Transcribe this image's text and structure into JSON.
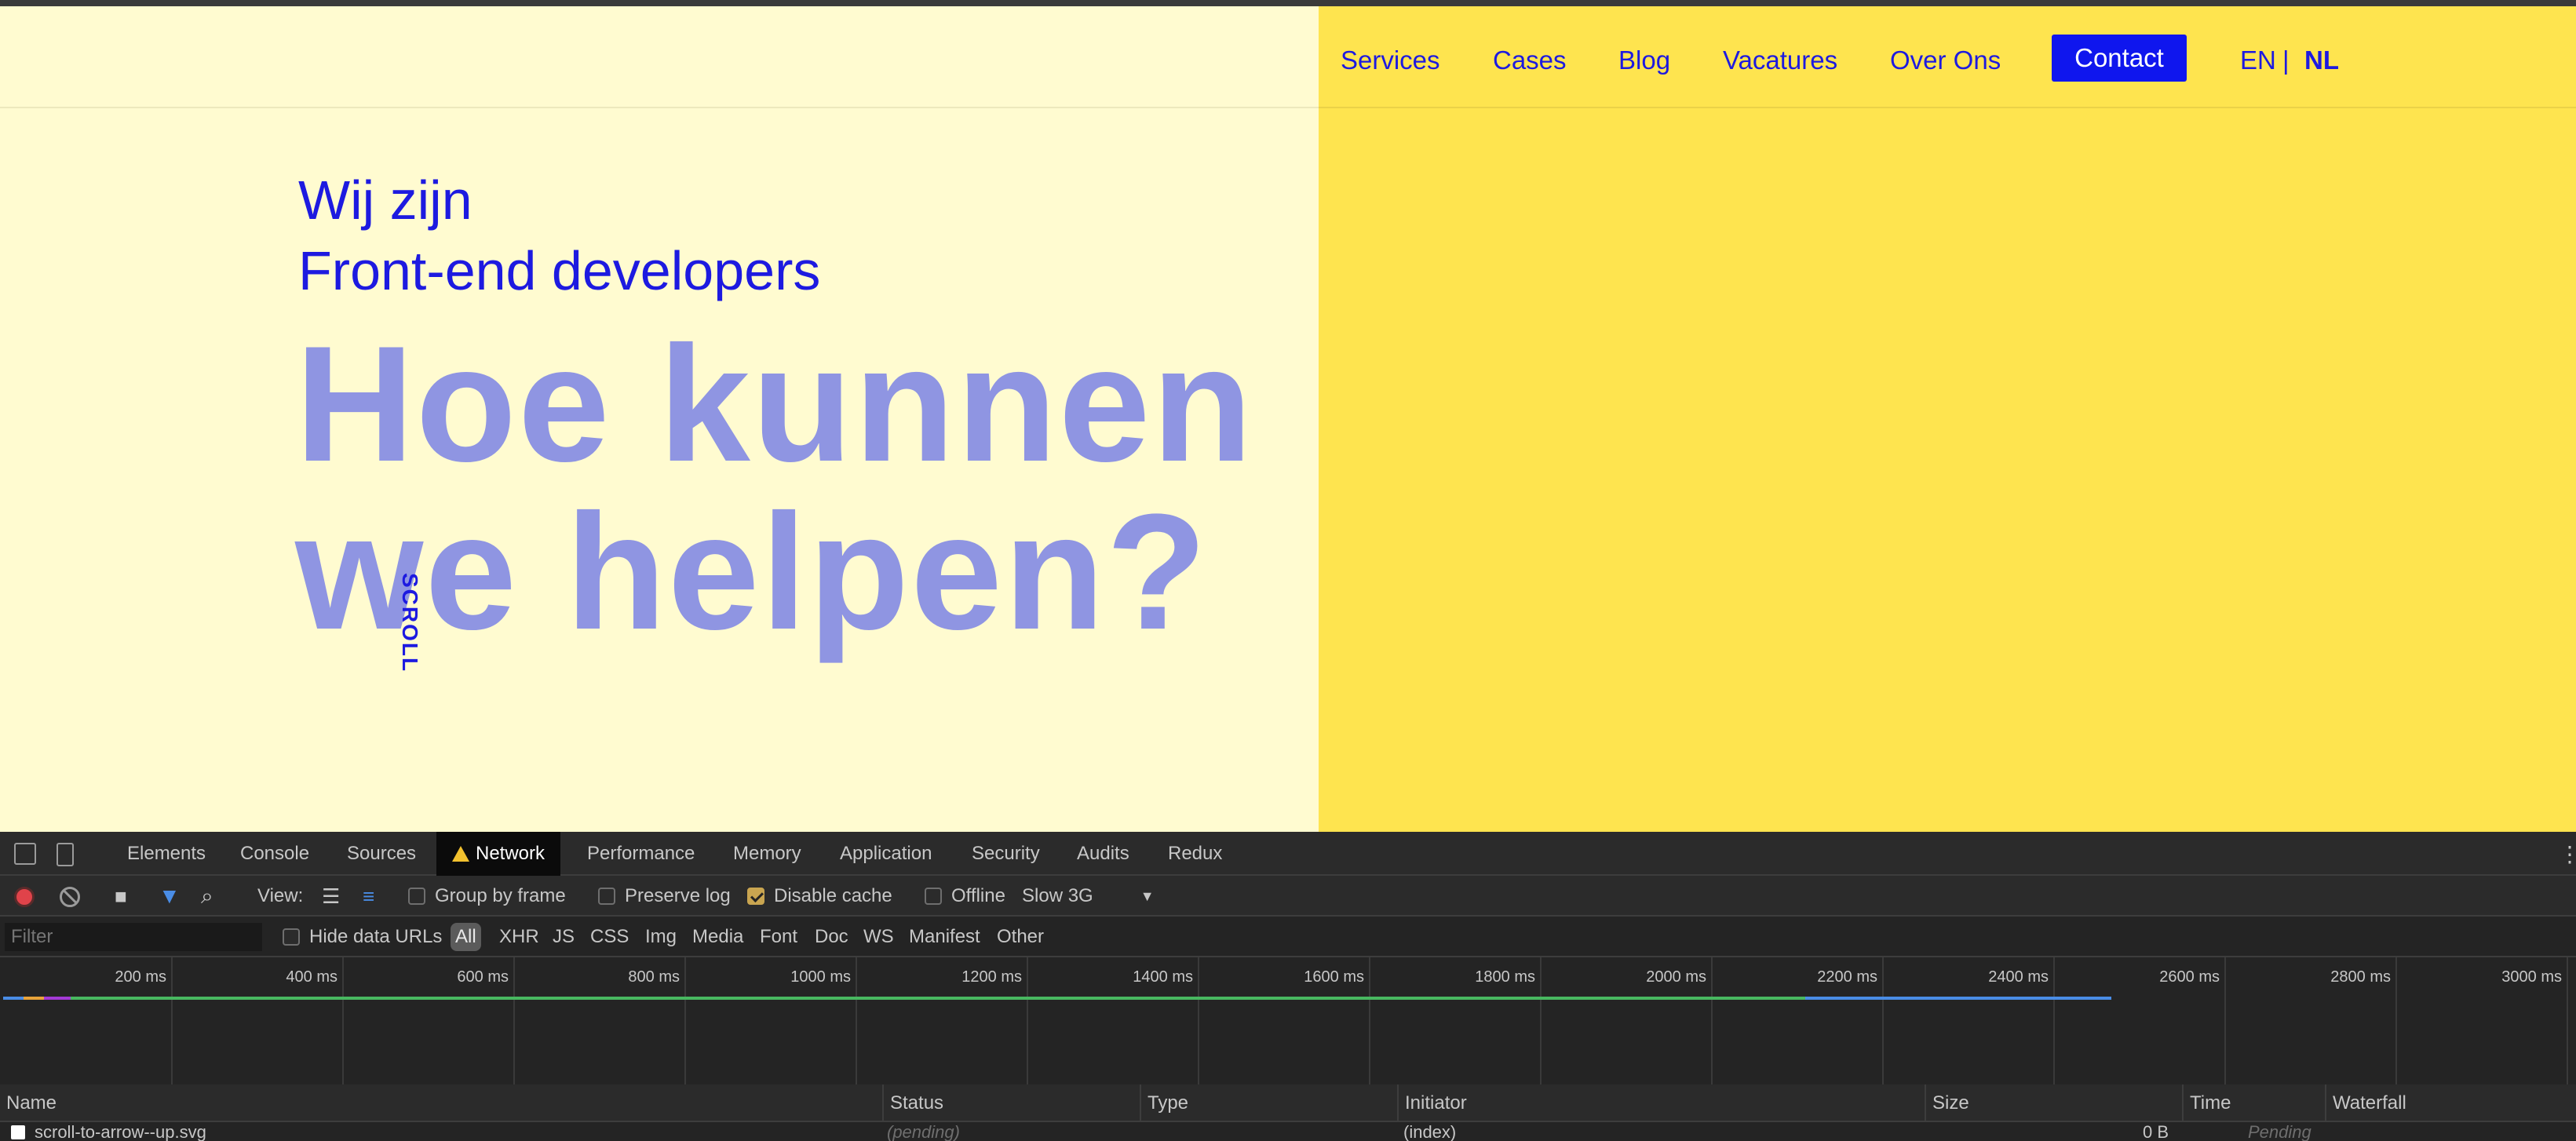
{
  "nav": {
    "links": [
      "Services",
      "Cases",
      "Blog",
      "Vacatures",
      "Over Ons"
    ],
    "contact": "Contact",
    "lang_en": "EN",
    "lang_sep": "|",
    "lang_nl": "NL"
  },
  "hero": {
    "intro_line1": "Wij zijn",
    "intro_line2": "Front-end developers",
    "headline_line1": "Hoe kunnen",
    "headline_line2": "we helpen?",
    "scroll_label": "SCROLL"
  },
  "colors": {
    "left_bg": "#fffbd0",
    "right_bg": "#fee44f",
    "brand_blue": "#1d1ae0",
    "headline": "#8f95e2"
  },
  "devtools": {
    "tabs": [
      "Elements",
      "Console",
      "Sources",
      "Network",
      "Performance",
      "Memory",
      "Application",
      "Security",
      "Audits",
      "Redux"
    ],
    "active_tab": "Network",
    "toolbar": {
      "view_label": "View:",
      "group_by_frame": "Group by frame",
      "preserve_log": "Preserve log",
      "disable_cache": "Disable cache",
      "offline": "Offline",
      "throttle": "Slow 3G"
    },
    "filter": {
      "placeholder": "Filter",
      "hide_data_urls": "Hide data URLs",
      "types": [
        "All",
        "XHR",
        "JS",
        "CSS",
        "Img",
        "Media",
        "Font",
        "Doc",
        "WS",
        "Manifest",
        "Other"
      ],
      "active_type": "All"
    },
    "timeline_ticks": [
      "200 ms",
      "400 ms",
      "600 ms",
      "800 ms",
      "1000 ms",
      "1200 ms",
      "1400 ms",
      "1600 ms",
      "1800 ms",
      "2000 ms",
      "2200 ms",
      "2400 ms",
      "2600 ms",
      "2800 ms",
      "3000 ms"
    ],
    "columns": [
      "Name",
      "Status",
      "Type",
      "Initiator",
      "Size",
      "Time",
      "Waterfall"
    ],
    "rows": [
      {
        "name": "scroll-to-arrow--up.svg",
        "status": "(pending)",
        "type": "",
        "initiator": "(index)",
        "size": "0 B",
        "time": "Pending"
      }
    ]
  }
}
